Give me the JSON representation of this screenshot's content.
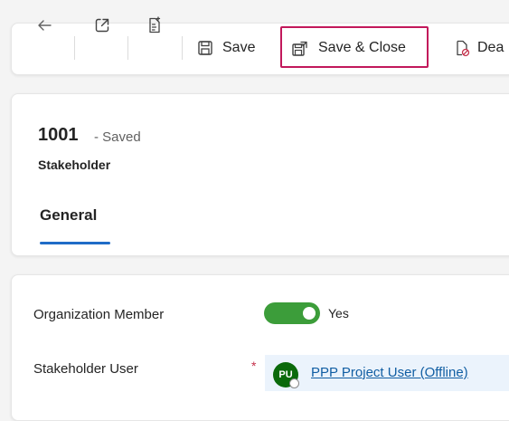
{
  "toolbar": {
    "back_icon": "arrow-left-icon",
    "open_new_window_icon": "open-in-new-window-icon",
    "process_icon": "document-flow-icon",
    "save_icon": "floppy-disk-icon",
    "save_label": "Save",
    "save_close_icon": "save-and-close-icon",
    "save_close_label": "Save & Close",
    "deactivate_icon": "document-deactivate-icon",
    "deactivate_label": "Dea",
    "highlight_color": "#c2185b"
  },
  "header": {
    "record_title": "1001",
    "record_status": "- Saved",
    "entity_name": "Stakeholder",
    "tabs": [
      {
        "label": "General",
        "selected": true
      }
    ],
    "accent_color": "#1f6cc7"
  },
  "form": {
    "organization_member": {
      "label": "Organization Member",
      "value": "Yes",
      "toggle_on": true,
      "toggle_color": "#3c9d3a"
    },
    "stakeholder_user": {
      "label": "Stakeholder User",
      "required_mark": "*",
      "avatar_initials": "PU",
      "avatar_color": "#0b6a0b",
      "value": "PPP Project User (Offline)"
    }
  }
}
